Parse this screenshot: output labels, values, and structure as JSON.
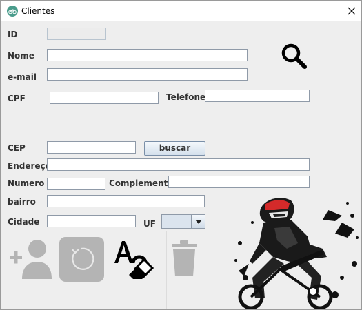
{
  "window": {
    "title": "Clientes"
  },
  "labels": {
    "id": "ID",
    "nome": "Nome",
    "email": "e-mail",
    "cpf": "CPF",
    "telefone": "Telefone",
    "cep": "CEP",
    "endereco": "Endereço",
    "numero": "Numero",
    "complemento": "Complemento",
    "bairro": "bairro",
    "cidade": "Cidade",
    "uf": "UF"
  },
  "fields": {
    "id": "",
    "nome": "",
    "email": "",
    "cpf": "",
    "telefone": "",
    "cep": "",
    "endereco": "",
    "numero": "",
    "complemento": "",
    "bairro": "",
    "cidade": "",
    "uf": ""
  },
  "buttons": {
    "buscar": "buscar"
  },
  "icons": {
    "app": "bicycle-icon",
    "close": "close-icon",
    "search": "search-icon",
    "add_user": "add-user-icon",
    "refresh": "refresh-icon",
    "clear": "eraser-icon",
    "delete": "trash-icon",
    "brand_image": "mountain-biker-illustration"
  },
  "colors": {
    "window_bg": "#eeeeee",
    "disabled_icon": "#b4b4b4",
    "helmet_red": "#d42a2a"
  }
}
